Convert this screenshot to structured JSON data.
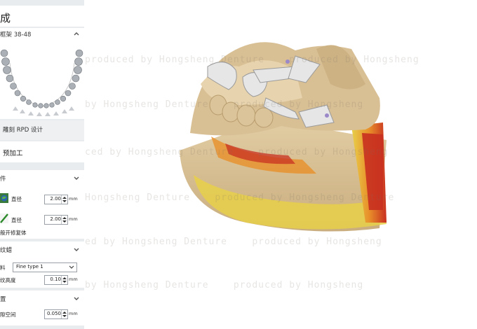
{
  "panel": {
    "title": "成",
    "framework": {
      "label": "框架 38-48"
    },
    "rpd_tab": {
      "label": "雕刻 RPD 设计"
    },
    "preprocess": {
      "label": "预加工"
    },
    "components": {
      "header": "件",
      "row1": {
        "label": "直径",
        "value": "2.00",
        "unit": "mm"
      },
      "row2": {
        "label": "直径",
        "value": "2.00",
        "unit": "mm"
      },
      "note": "般开修复体"
    },
    "wax": {
      "header": "纹蜡",
      "type_label": "料",
      "type_value": "Fine type 1",
      "height_label": "纹高度",
      "height_value": "0.10",
      "unit": "mm"
    },
    "placement": {
      "header": "置",
      "gap_label": "隙空间",
      "gap_value": "0.050",
      "unit": "mm"
    }
  },
  "watermark": {
    "line1": "produced by Hongsheng Denture    produced by Hongsheng",
    "line2": "by Hongsheng Denture    produced by Hongsheng",
    "line3": "ced by Hongsheng Denture    produced by Hongsheng",
    "line4": "Hongsheng Denture    produced by Hongsheng Denture",
    "line5": "ed by Hongsheng Denture    produced by Hongsheng",
    "line6": "by Hongsheng Denture    produced by Hongsheng"
  },
  "colors": {
    "panel_bg": "#e9ecef",
    "model_base": "#d8bf94",
    "framework_metal": "#e4e4e4",
    "heat_yellow": "#e8d04a",
    "heat_orange": "#e8902a",
    "heat_red": "#c83020"
  },
  "icons": [
    "chevron-down-icon",
    "globe-icon",
    "pen-icon",
    "spin-up-down-icon",
    "dropdown-arrow-icon"
  ]
}
